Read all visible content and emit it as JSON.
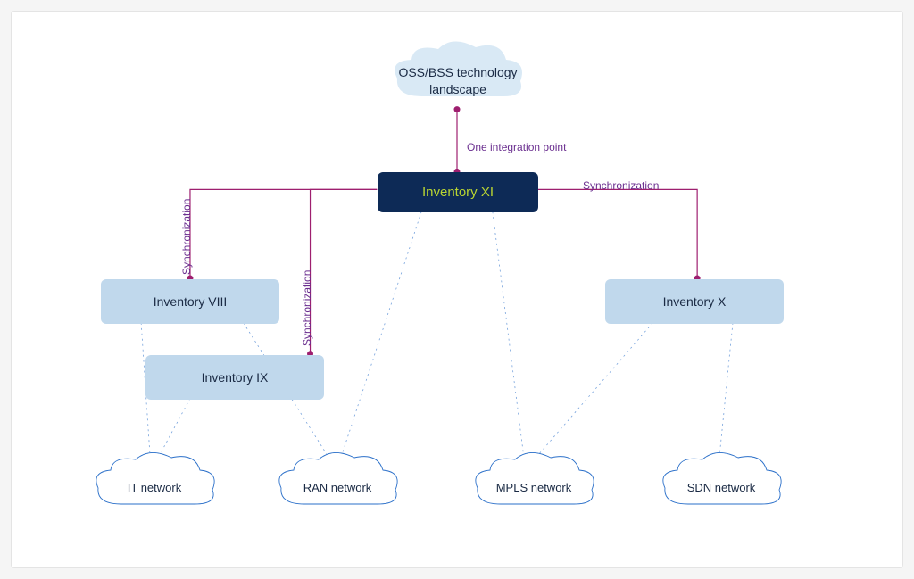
{
  "top_cloud": {
    "label": "OSS/BSS technology\nlandscape"
  },
  "main": {
    "label": "Inventory XI"
  },
  "inv8": {
    "label": "Inventory VIII"
  },
  "inv9": {
    "label": "Inventory IX"
  },
  "inv10": {
    "label": "Inventory X"
  },
  "clouds": {
    "it": {
      "label": "IT network"
    },
    "ran": {
      "label": "RAN network"
    },
    "mpls": {
      "label": "MPLS network"
    },
    "sdn": {
      "label": "SDN network"
    }
  },
  "edges": {
    "one_integration": "One integration point",
    "sync8": "Synchronization",
    "sync9": "Synchronization",
    "sync10": "Synchronization"
  },
  "colors": {
    "navy": "#0d2a56",
    "lightblue": "#c0d8ec",
    "magenta": "#9e1f6f",
    "lime": "#b8d432",
    "cloud_stroke": "#2a6fc9"
  }
}
